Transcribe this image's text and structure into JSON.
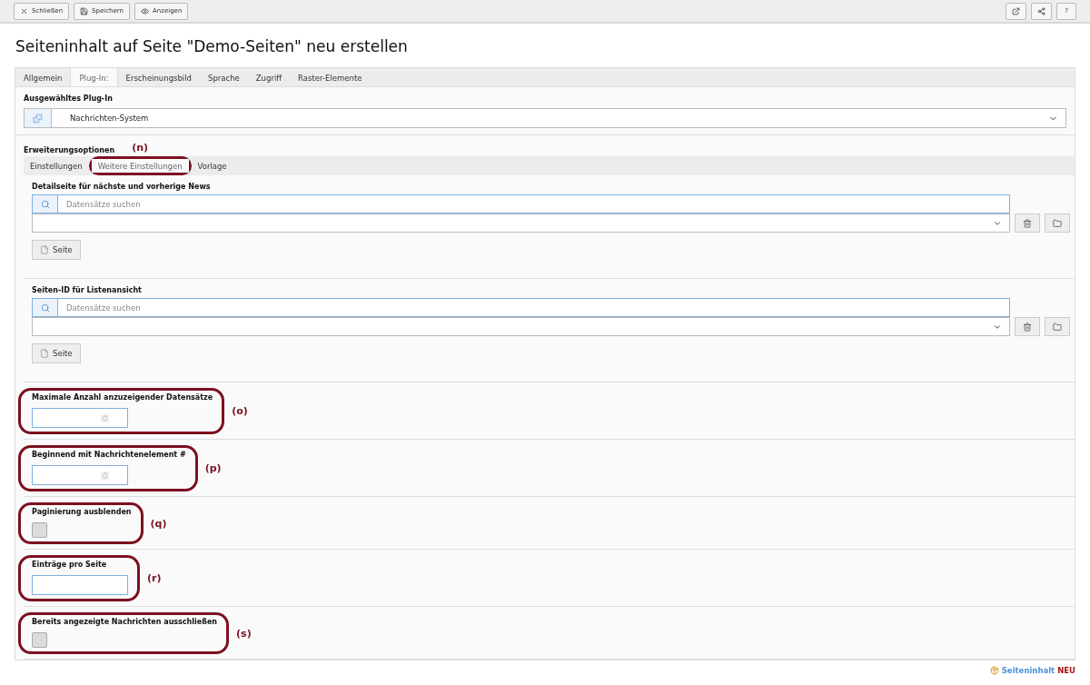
{
  "toolbar": {
    "left": [
      {
        "kind": "close",
        "label": "Schließen"
      },
      {
        "kind": "save",
        "label": "Speichern"
      },
      {
        "kind": "view",
        "label": "Anzeigen"
      }
    ],
    "right": [
      {
        "kind": "external"
      },
      {
        "kind": "share"
      },
      {
        "kind": "help",
        "label": "?"
      }
    ]
  },
  "title": "Seiteninhalt auf Seite \"Demo-Seiten\" neu erstellen",
  "tabs": [
    {
      "label": "Allgemein",
      "selected": false
    },
    {
      "label": "Plug-In:",
      "selected": true
    },
    {
      "label": "Erscheinungsbild",
      "selected": false
    },
    {
      "label": "Sprache",
      "selected": false
    },
    {
      "label": "Zugriff",
      "selected": false
    },
    {
      "label": "Raster-Elemente",
      "selected": false
    }
  ],
  "plugin": {
    "label": "Ausgewähltes Plug-In",
    "value": "Nachrichten-System"
  },
  "options": {
    "label": "Erweiterungsoptionen",
    "tabs": [
      {
        "label": "Einstellungen",
        "selected": false
      },
      {
        "label": "Weitere Einstellungen",
        "selected": true,
        "annotation": "(n)"
      },
      {
        "label": "Vorlage",
        "selected": false
      }
    ],
    "selectors": [
      {
        "label": "Detailseite für nächste und vorherige News",
        "placeholder": "Datensätze suchen",
        "button": "Seite"
      },
      {
        "label": "Seiten-ID für Listenansicht",
        "placeholder": "Datensätze suchen",
        "button": "Seite"
      }
    ],
    "fields": [
      {
        "kind": "number",
        "label": "Maximale Anzahl anzuzeigender Datensätze",
        "annotation": "(o)"
      },
      {
        "kind": "number",
        "label": "Beginnend mit Nachrichtenelement #",
        "annotation": "(p)"
      },
      {
        "kind": "checkbox",
        "label": "Paginierung ausblenden",
        "checked": false,
        "annotation": "(q)"
      },
      {
        "kind": "text",
        "label": "Einträge pro Seite",
        "annotation": "(r)"
      },
      {
        "kind": "checkbox",
        "label": "Bereits angezeigte Nachrichten ausschließen",
        "checked": false,
        "annotation": "(s)"
      }
    ]
  },
  "footer": {
    "link": "Seiteninhalt",
    "badge": "NEU"
  }
}
